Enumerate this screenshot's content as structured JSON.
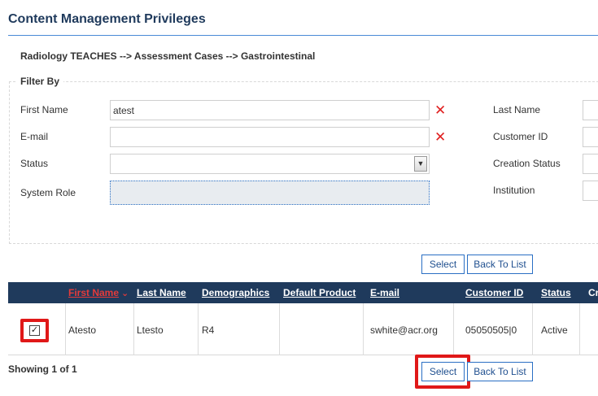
{
  "page": {
    "title": "Content Management Privileges",
    "breadcrumb": "Radiology TEACHES --> Assessment Cases --> Gastrointestinal"
  },
  "filter": {
    "legend": "Filter By",
    "first_name_label": "First Name",
    "first_name_value": "atest",
    "email_label": "E-mail",
    "email_value": "",
    "status_label": "Status",
    "status_value": "",
    "system_role_label": "System Role",
    "last_name_label": "Last Name",
    "customer_id_label": "Customer ID",
    "creation_status_label": "Creation Status",
    "institution_label": "Institution"
  },
  "actions": {
    "select_label": "Select",
    "back_label": "Back To List"
  },
  "table": {
    "columns": [
      "First Name",
      "Last Name",
      "Demographics",
      "Default Product",
      "E-mail",
      "Customer ID",
      "Status",
      "Cr"
    ],
    "sort_column": "First Name",
    "rows": [
      {
        "selected": true,
        "first_name": "Atesto",
        "last_name": "Ltesto",
        "demographics": "R4",
        "default_product": "",
        "email": "swhite@acr.org",
        "customer_id": "05050505|0",
        "status": "Active"
      }
    ]
  },
  "footer": {
    "showing": "Showing 1 of 1"
  },
  "icons": {
    "clear": "close-x-icon",
    "dropdown": "chevron-down-icon",
    "sort": "sort-down-icon",
    "check": "checkmark-icon"
  },
  "colors": {
    "header_bg": "#1f3a5c",
    "accent": "#2a6fc4",
    "highlight": "#e01818",
    "clear_icon": "#e02020"
  }
}
